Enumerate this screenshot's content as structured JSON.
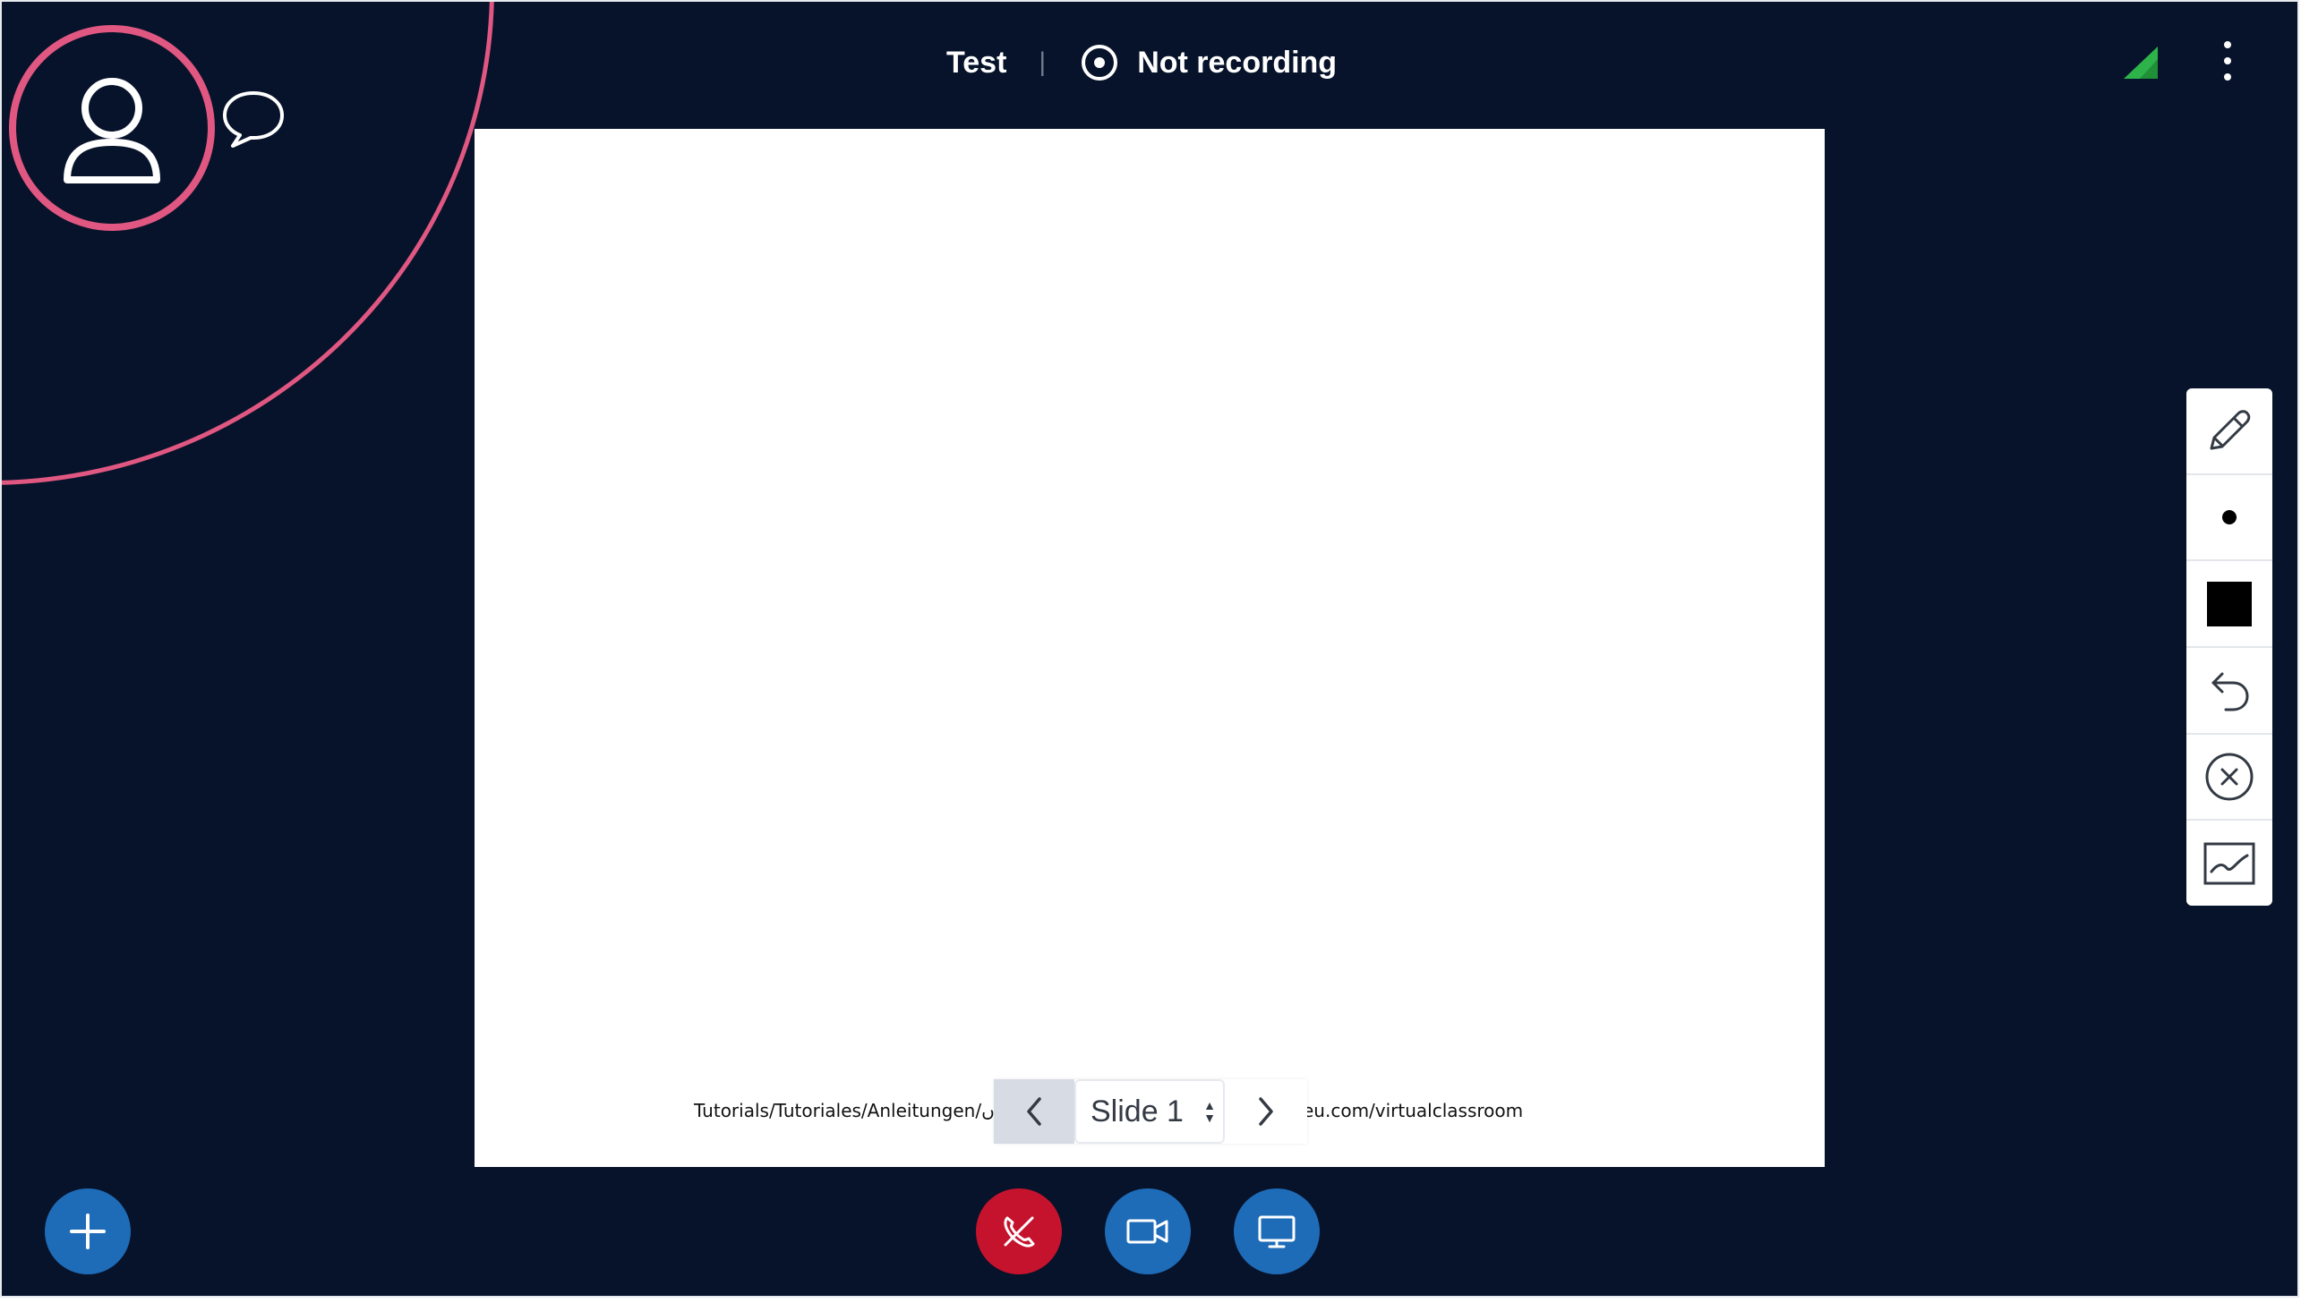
{
  "header": {
    "meeting_title": "Test",
    "separator": "|",
    "recording_status": "Not recording"
  },
  "presentation": {
    "url_left": "Tutorials/Tutoriales/Anleitungen/ں",
    "url_right": "eu.com/virtualclassroom",
    "current_slide_label": "Slide 1"
  },
  "icons": {
    "avatar": "user-icon",
    "chat": "chat-bubble-icon",
    "connection": "signal-strength-icon",
    "options": "kebab-menu-icon",
    "prev": "chevron-left-icon",
    "next": "chevron-right-icon",
    "pencil": "pencil-icon",
    "thickness": "dot-icon",
    "color": "square-icon",
    "undo": "undo-icon",
    "clear": "clear-circle-x-icon",
    "multiuser": "chart-line-icon",
    "actions": "plus-icon",
    "leave_audio": "phone-off-icon",
    "camera": "video-camera-icon",
    "screenshare": "monitor-icon"
  },
  "colors": {
    "background": "#07132a",
    "accent_pink": "#e05782",
    "primary_blue": "#1e6bb8",
    "danger_red": "#c6132d",
    "signal_green": "#2db34a"
  }
}
